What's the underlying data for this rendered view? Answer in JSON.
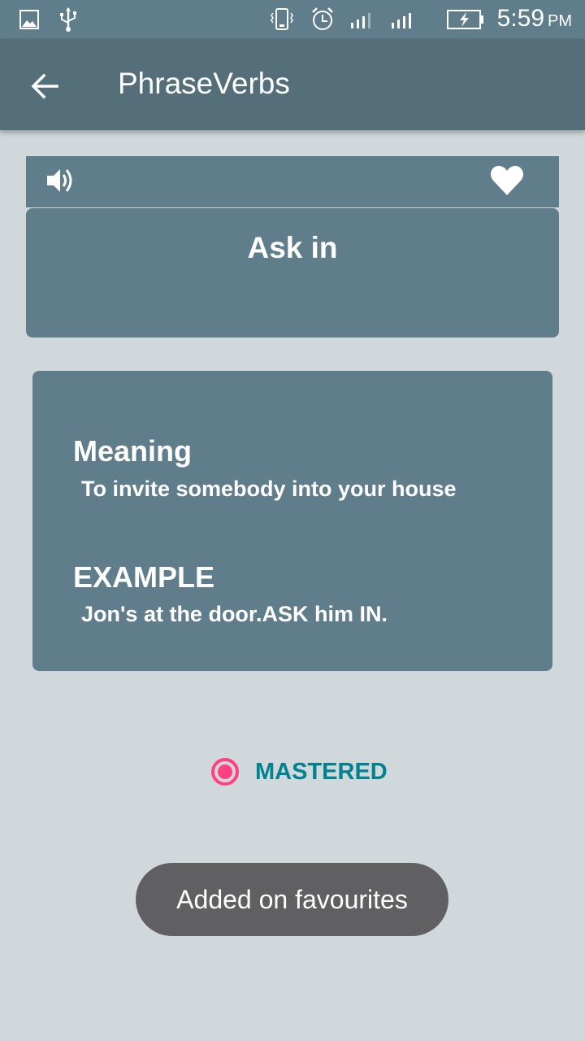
{
  "status_bar": {
    "time": "5:59",
    "ampm": "PM",
    "left_icons": [
      "image-icon",
      "usb-icon"
    ],
    "right_icons": [
      "vibrate-icon",
      "alarm-icon",
      "signal-icon",
      "signal-icon",
      "battery-charging-icon"
    ]
  },
  "app_bar": {
    "title": "PhraseVerbs",
    "back_icon": "arrow-back-icon"
  },
  "phrase_card": {
    "speaker_icon": "volume-icon",
    "favorite_icon": "heart-icon",
    "phrase": "Ask in"
  },
  "details": {
    "meaning_label": "Meaning",
    "meaning_text": "To invite somebody into your house",
    "example_label": "EXAMPLE",
    "example_text": "Jon's at the door.ASK him IN."
  },
  "mastered": {
    "label": "MASTERED",
    "checked": true
  },
  "toast": {
    "message": "Added on favourites"
  },
  "colors": {
    "background": "#d0d8dc",
    "status_bar": "#607d8b",
    "app_bar": "#546e7a",
    "card": "#607d8b",
    "accent": "#ff4081",
    "mastered_text": "#00838f",
    "toast": "#606062"
  }
}
